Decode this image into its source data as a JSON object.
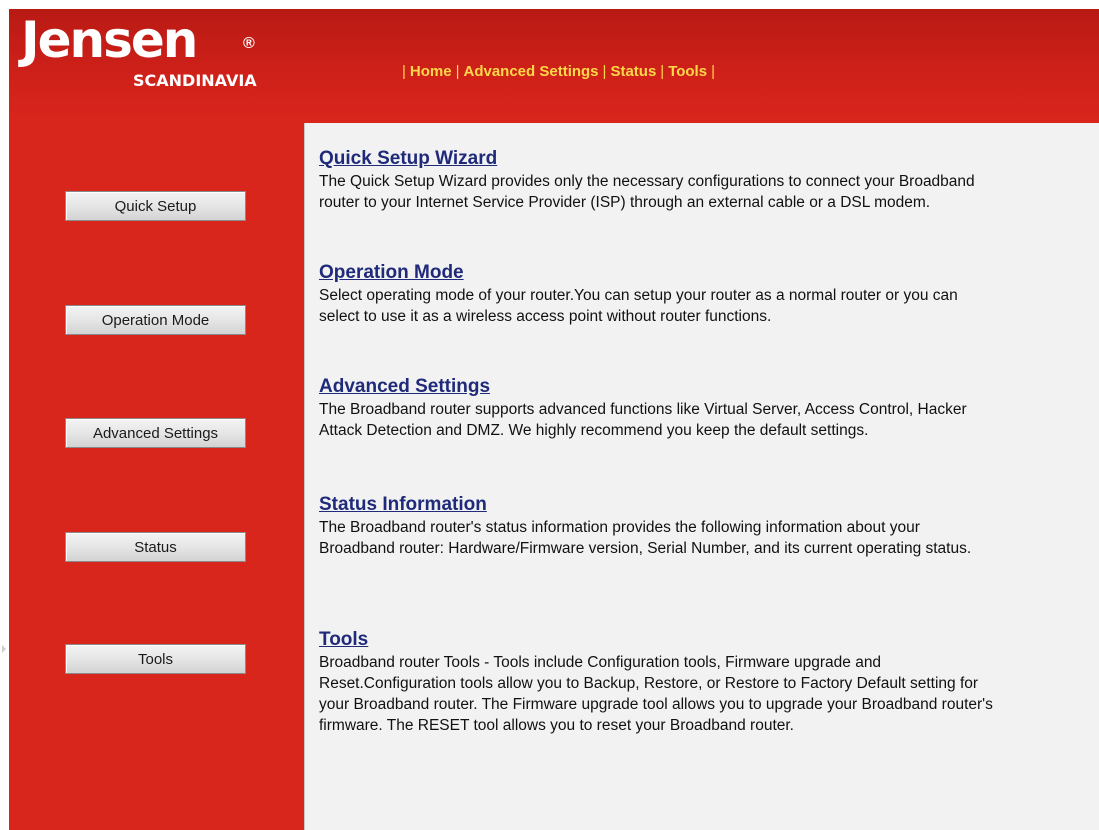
{
  "brand": {
    "name": "Jensen",
    "registered": "®",
    "subtitle": "SCANDINAVIA"
  },
  "topnav": {
    "items": [
      "Home",
      "Advanced Settings",
      "Status",
      "Tools"
    ]
  },
  "sidebar": {
    "buttons": [
      "Quick Setup",
      "Operation Mode",
      "Advanced Settings",
      "Status",
      "Tools"
    ]
  },
  "sections": [
    {
      "title": "Quick Setup Wizard",
      "text": "The Quick Setup Wizard provides only the necessary configurations to connect your Broadband router to your Internet Service Provider (ISP) through an external cable or a DSL modem."
    },
    {
      "title": "Operation Mode",
      "text": "Select operating mode of your router.You can setup your router as a normal router or you can select to use it as a wireless access point without router functions."
    },
    {
      "title": "Advanced Settings",
      "text": "The Broadband router supports advanced functions like Virtual Server, Access Control, Hacker Attack Detection and DMZ. We highly recommend you keep the default settings."
    },
    {
      "title": "Status Information",
      "text": "The Broadband router's status information provides the following information about your Broadband router: Hardware/Firmware version, Serial Number, and its current operating status."
    },
    {
      "title": "Tools",
      "text": "Broadband router Tools - Tools include Configuration tools, Firmware upgrade and Reset.Configuration tools allow you to Backup, Restore, or Restore to Factory Default setting for your Broadband router. The Firmware upgrade tool allows you to upgrade your Broadband router's firmware. The RESET tool allows you to reset your Broadband router."
    }
  ],
  "colors": {
    "brand_red": "#d9261d",
    "nav_link": "#ffd84a",
    "heading_link": "#1f2a7a",
    "content_bg": "#f2f2f2"
  }
}
